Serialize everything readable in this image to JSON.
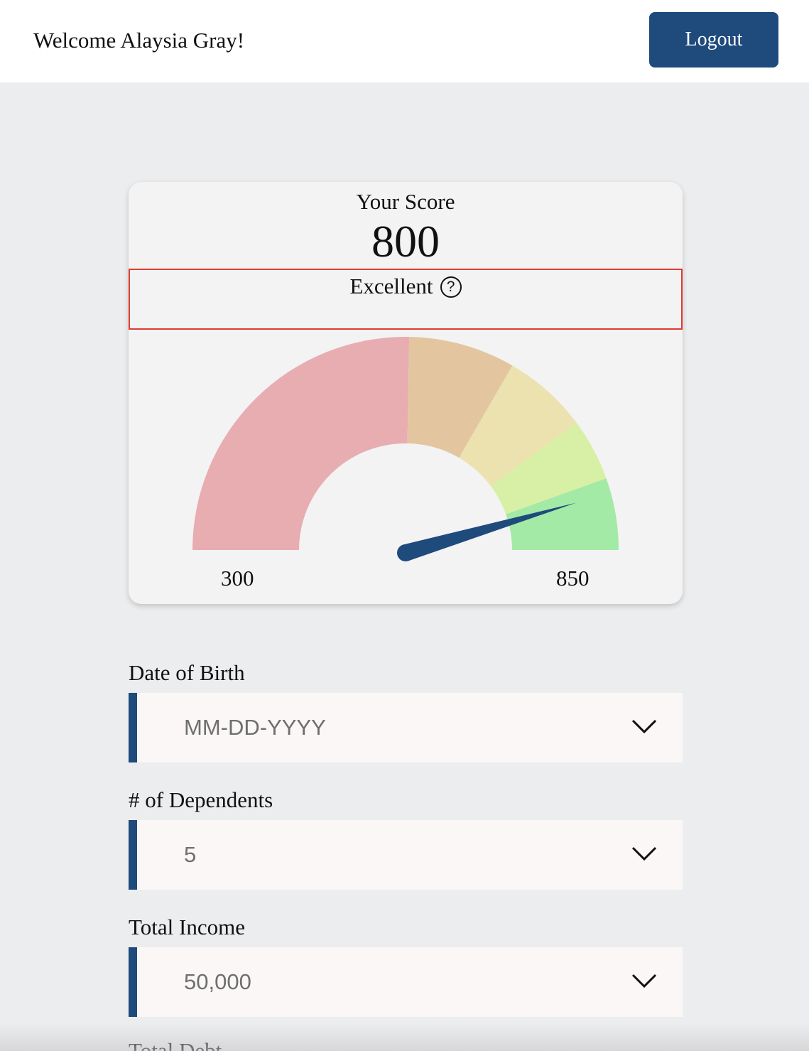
{
  "header": {
    "welcome_text": "Welcome Alaysia Gray!",
    "logout_label": "Logout",
    "logout_color": "#1e4a7c"
  },
  "score_card": {
    "title": "Your Score",
    "score": "800",
    "rating": "Excellent",
    "help_icon": "question-circle-icon",
    "help_glyph": "?",
    "min_label": "300",
    "max_label": "850",
    "gauge": {
      "min": 300,
      "max": 850,
      "value": 800,
      "bands": [
        {
          "from": 300,
          "to": 578,
          "color": "#e8adb1"
        },
        {
          "from": 578,
          "to": 667,
          "color": "#e3c6a0"
        },
        {
          "from": 667,
          "to": 738,
          "color": "#ebe2af"
        },
        {
          "from": 738,
          "to": 790,
          "color": "#d8f0a5"
        },
        {
          "from": 790,
          "to": 850,
          "color": "#a3eaa6"
        }
      ],
      "needle_color": "#1e4a7c"
    }
  },
  "form": {
    "fields": [
      {
        "label": "Date of Birth",
        "value": "MM-DD-YYYY",
        "icon": "chevron-down-icon"
      },
      {
        "label": "# of Dependents",
        "value": "5",
        "icon": "chevron-down-icon"
      },
      {
        "label": "Total Income",
        "value": "50,000",
        "icon": "chevron-down-icon"
      },
      {
        "label": "Total Debt"
      }
    ]
  },
  "colors": {
    "accent": "#1e4a7c",
    "highlight_border": "#e03c2f"
  }
}
